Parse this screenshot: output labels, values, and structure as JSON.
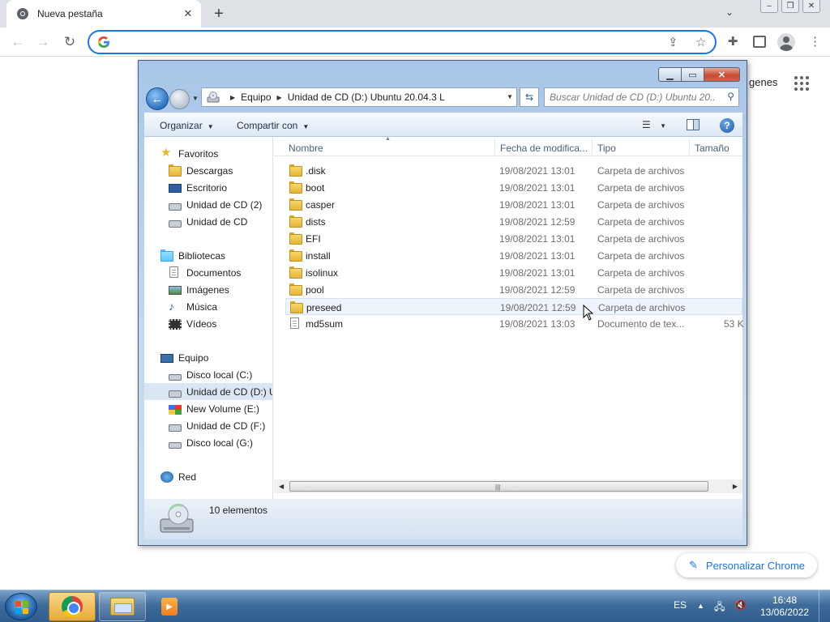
{
  "browser": {
    "tab_title": "Nueva pestaña",
    "tab_close": "✕",
    "new_tab": "+",
    "address_value": "",
    "ntp_images_link": "genes",
    "customize_label": "Personalizar Chrome"
  },
  "explorer": {
    "breadcrumb": [
      "Equipo",
      "Unidad de CD (D:) Ubuntu 20.04.3 L"
    ],
    "search_placeholder": "Buscar Unidad de CD (D:) Ubuntu 20....",
    "commands": {
      "organize": "Organizar",
      "share": "Compartir con"
    },
    "nav": {
      "favorites": {
        "label": "Favoritos",
        "items": [
          "Descargas",
          "Escritorio",
          "Unidad de CD (2)",
          "Unidad de CD"
        ]
      },
      "libraries": {
        "label": "Bibliotecas",
        "items": [
          "Documentos",
          "Imágenes",
          "Música",
          "Vídeos"
        ]
      },
      "computer": {
        "label": "Equipo",
        "items": [
          "Disco local (C:)",
          "Unidad de CD (D:) U",
          "New Volume (E:)",
          "Unidad de CD (F:)",
          "Disco local (G:)"
        ]
      },
      "network": {
        "label": "Red"
      }
    },
    "columns": {
      "name": "Nombre",
      "date": "Fecha de modifica...",
      "type": "Tipo",
      "size": "Tamaño"
    },
    "files": [
      {
        "name": ".disk",
        "date": "19/08/2021 13:01",
        "type": "Carpeta de archivos",
        "size": "",
        "kind": "folder"
      },
      {
        "name": "boot",
        "date": "19/08/2021 13:01",
        "type": "Carpeta de archivos",
        "size": "",
        "kind": "folder"
      },
      {
        "name": "casper",
        "date": "19/08/2021 13:01",
        "type": "Carpeta de archivos",
        "size": "",
        "kind": "folder"
      },
      {
        "name": "dists",
        "date": "19/08/2021 12:59",
        "type": "Carpeta de archivos",
        "size": "",
        "kind": "folder"
      },
      {
        "name": "EFI",
        "date": "19/08/2021 13:01",
        "type": "Carpeta de archivos",
        "size": "",
        "kind": "folder"
      },
      {
        "name": "install",
        "date": "19/08/2021 13:01",
        "type": "Carpeta de archivos",
        "size": "",
        "kind": "folder"
      },
      {
        "name": "isolinux",
        "date": "19/08/2021 13:01",
        "type": "Carpeta de archivos",
        "size": "",
        "kind": "folder"
      },
      {
        "name": "pool",
        "date": "19/08/2021 12:59",
        "type": "Carpeta de archivos",
        "size": "",
        "kind": "folder"
      },
      {
        "name": "preseed",
        "date": "19/08/2021 12:59",
        "type": "Carpeta de archivos",
        "size": "",
        "kind": "folder"
      },
      {
        "name": "md5sum",
        "date": "19/08/2021 13:03",
        "type": "Documento de tex...",
        "size": "53 K",
        "kind": "document"
      }
    ],
    "details_count": "10 elementos"
  },
  "taskbar": {
    "language": "ES",
    "time": "16:48",
    "date": "13/06/2022"
  }
}
